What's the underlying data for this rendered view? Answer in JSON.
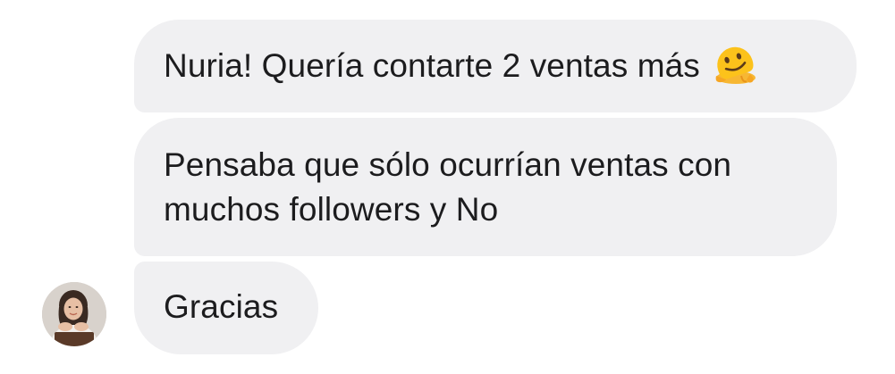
{
  "messages": [
    {
      "text": "Nuria! Quería contarte 2 ventas más",
      "emoji": "melting-face-emoji"
    },
    {
      "lines": [
        "Pensaba que sólo ocurrían ventas con",
        "muchos followers y No"
      ]
    },
    {
      "text": "Gracias"
    }
  ],
  "colors": {
    "bubble_background": "#f0f0f2",
    "text": "#1c1c1e",
    "page_background": "#ffffff"
  }
}
